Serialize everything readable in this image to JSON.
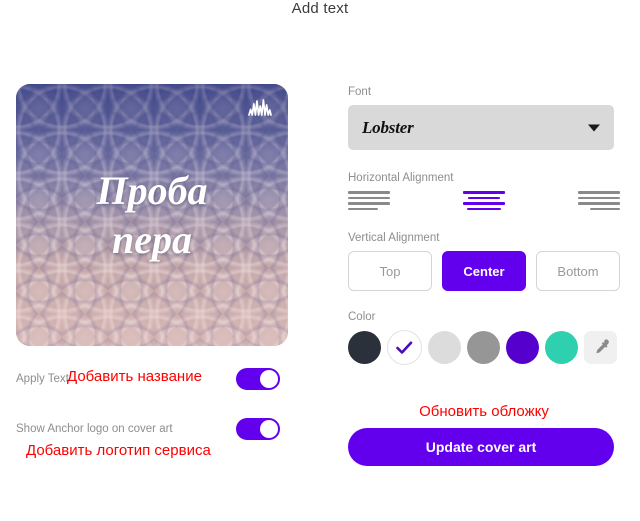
{
  "page": {
    "title": "Add text"
  },
  "cover": {
    "line1": "Проба",
    "line2": "пера",
    "logo_icon": "anchor-waveform-icon"
  },
  "toggles": [
    {
      "label": "Apply Text",
      "state": "on",
      "annotation": "Добавить название"
    },
    {
      "label": "Show Anchor logo on cover art",
      "state": "on",
      "annotation": "Добавить логотип сервиса"
    }
  ],
  "font": {
    "label": "Font",
    "selected": "Lobster",
    "chevron_icon": "chevron-down-icon"
  },
  "horizontal_alignment": {
    "label": "Horizontal Alignment",
    "options": [
      "left",
      "center",
      "right"
    ],
    "selected": "center"
  },
  "vertical_alignment": {
    "label": "Vertical Alignment",
    "options": [
      {
        "label": "Top",
        "selected": false
      },
      {
        "label": "Center",
        "selected": true
      },
      {
        "label": "Bottom",
        "selected": false
      }
    ]
  },
  "color": {
    "label": "Color",
    "swatches": [
      {
        "hex": "#2b313b",
        "selected": false
      },
      {
        "hex": "#ffffff",
        "selected": true
      },
      {
        "hex": "#dcdcdc",
        "selected": false
      },
      {
        "hex": "#969696",
        "selected": false
      },
      {
        "hex": "#5500cc",
        "selected": false
      },
      {
        "hex": "#2fd0b0",
        "selected": false
      }
    ],
    "eyedropper_icon": "eyedropper-icon",
    "check_color": "#4b0bbd"
  },
  "actions": {
    "update_annotation": "Обновить обложку",
    "update_label": "Update cover art"
  },
  "theme": {
    "accent": "#6200ee",
    "annotation": "#ff0000",
    "muted_text": "#8e8e8e"
  }
}
